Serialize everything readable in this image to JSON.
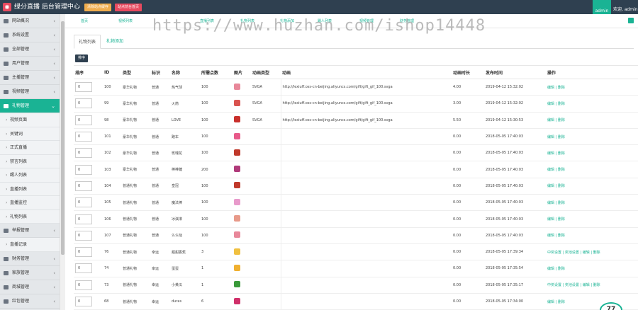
{
  "app": {
    "logo_glyph": "◉",
    "title": "绿分直播 后台管理中心"
  },
  "topbar": {
    "clear_cache": "清除站点缓存",
    "site_home": "站点前台首页",
    "avatar_text": "admin",
    "welcome": "欢迎, admin"
  },
  "sidebar": {
    "items_top": [
      {
        "label": "网站概况"
      },
      {
        "label": "系统设置"
      },
      {
        "label": "全部管理"
      },
      {
        "label": "用户管理"
      },
      {
        "label": "主播管理"
      },
      {
        "label": "视频管理"
      }
    ],
    "active": {
      "label": "礼物管理"
    },
    "subs": [
      {
        "label": "视频页面"
      },
      {
        "label": "关键词"
      },
      {
        "label": "正式直播"
      },
      {
        "label": "禁言列表"
      },
      {
        "label": "踢人列表"
      },
      {
        "label": "直播列表"
      },
      {
        "label": "直播监控"
      },
      {
        "label": "礼物列表"
      }
    ],
    "mid": {
      "label": "举报管理"
    },
    "sub2": {
      "label": "直播记录"
    },
    "items_bottom": [
      {
        "label": "财务管理"
      },
      {
        "label": "家族管理"
      },
      {
        "label": "商城管理"
      },
      {
        "label": "红包管理"
      },
      {
        "label": "守护管理"
      }
    ]
  },
  "tabbar": [
    "首页",
    "视频列表",
    "直播列表",
    "礼物列表",
    "礼物添加",
    "踢人列表",
    "视频管理",
    "财务管理"
  ],
  "watermark": "https://www.huzhan.com/ishop14448",
  "subtabs": {
    "list": "礼物列表",
    "add": "礼物添加"
  },
  "sort_button": "排序",
  "table": {
    "headers": [
      "排序",
      "ID",
      "类型",
      "标识",
      "名称",
      "所需点数",
      "图片",
      "动画类型",
      "动画",
      "动画时长",
      "发布时间",
      "操作"
    ],
    "rows": [
      {
        "order": "0",
        "id": "100",
        "type": "豪华礼物",
        "mark": "普通",
        "name": "热气球",
        "points": "100",
        "anim_type": "SVGA",
        "anim": "http://lexiuff.oss-cn-beijing.aliyuncs.com/gift/gift_gif_100.svga",
        "duration": "4.00",
        "time": "2019-04-12 15:32:02",
        "action": "编辑 | 删除",
        "color": "#e8889a"
      },
      {
        "order": "0",
        "id": "99",
        "type": "豪华礼物",
        "mark": "普通",
        "name": "火箭",
        "points": "100",
        "anim_type": "SVGA",
        "anim": "http://lexiuff.oss-cn-beijing.aliyuncs.com/gift/gift_gif_100.svga",
        "duration": "3.00",
        "time": "2019-04-12 15:32:02",
        "action": "编辑 | 删除",
        "color": "#d9534f"
      },
      {
        "order": "0",
        "id": "98",
        "type": "豪华礼物",
        "mark": "普通",
        "name": "LOVE",
        "points": "100",
        "anim_type": "SVGA",
        "anim": "http://lexiuff.oss-cn-beijing.aliyuncs.com/gift/gift_gif_100.svga",
        "duration": "5.50",
        "time": "2019-04-12 15:30:53",
        "action": "编辑 | 删除",
        "color": "#c9302c"
      },
      {
        "order": "0",
        "id": "101",
        "type": "豪华礼物",
        "mark": "普通",
        "name": "跑车",
        "points": "100",
        "anim_type": "",
        "anim": "",
        "duration": "0.00",
        "time": "2018-05-05 17:40:03",
        "action": "编辑 | 删除",
        "color": "#e85a8a"
      },
      {
        "order": "0",
        "id": "102",
        "type": "豪华礼物",
        "mark": "普通",
        "name": "玫瑰花",
        "points": "100",
        "anim_type": "",
        "anim": "",
        "duration": "0.00",
        "time": "2018-05-05 17:40:03",
        "action": "编辑 | 删除",
        "color": "#c0392b"
      },
      {
        "order": "0",
        "id": "103",
        "type": "豪华礼物",
        "mark": "普通",
        "name": "棒棒糖",
        "points": "200",
        "anim_type": "",
        "anim": "",
        "duration": "0.00",
        "time": "2018-05-05 17:40:03",
        "action": "编辑 | 删除",
        "color": "#b03a7a"
      },
      {
        "order": "0",
        "id": "104",
        "type": "普通礼物",
        "mark": "普通",
        "name": "皇冠",
        "points": "100",
        "anim_type": "",
        "anim": "",
        "duration": "0.00",
        "time": "2018-05-05 17:40:03",
        "action": "编辑 | 删除",
        "color": "#c0392b"
      },
      {
        "order": "0",
        "id": "105",
        "type": "普通礼物",
        "mark": "普通",
        "name": "魔法棒",
        "points": "100",
        "anim_type": "",
        "anim": "",
        "duration": "0.00",
        "time": "2018-05-05 17:40:03",
        "action": "编辑 | 删除",
        "color": "#e89acb"
      },
      {
        "order": "0",
        "id": "106",
        "type": "普通礼物",
        "mark": "普通",
        "name": "冰淇淋",
        "points": "100",
        "anim_type": "",
        "anim": "",
        "duration": "0.00",
        "time": "2018-05-05 17:40:03",
        "action": "编辑 | 删除",
        "color": "#e89a8a"
      },
      {
        "order": "0",
        "id": "107",
        "type": "普通礼物",
        "mark": "普通",
        "name": "么么哒",
        "points": "100",
        "anim_type": "",
        "anim": "",
        "duration": "0.00",
        "time": "2018-05-05 17:40:03",
        "action": "编辑 | 删除",
        "color": "#e8889a"
      },
      {
        "order": "0",
        "id": "76",
        "type": "普通礼物",
        "mark": "幸运",
        "name": "甜甜香蕉",
        "points": "3",
        "anim_type": "",
        "anim": "",
        "duration": "0.00",
        "time": "2018-05-05 17:39:34",
        "action": "中奖设置 | 奖池设置 | 编辑 | 删除",
        "color": "#f0c040"
      },
      {
        "order": "0",
        "id": "74",
        "type": "普通礼物",
        "mark": "幸运",
        "name": "蛋蛋",
        "points": "1",
        "anim_type": "",
        "anim": "",
        "duration": "0.00",
        "time": "2018-05-05 17:35:54",
        "action": "编辑 | 删除",
        "color": "#f0b030"
      },
      {
        "order": "0",
        "id": "73",
        "type": "普通礼物",
        "mark": "幸运",
        "name": "小黄瓜",
        "points": "1",
        "anim_type": "",
        "anim": "",
        "duration": "0.00",
        "time": "2018-05-05 17:35:17",
        "action": "中奖设置 | 奖池设置 | 编辑 | 删除",
        "color": "#3a9a3a"
      },
      {
        "order": "0",
        "id": "68",
        "type": "普通礼物",
        "mark": "幸运",
        "name": "duras",
        "points": "6",
        "anim_type": "",
        "anim": "",
        "duration": "0.00",
        "time": "2018-05-05 17:34:00",
        "action": "编辑 | 删除",
        "color": "#d0306a"
      }
    ]
  },
  "badge": "77"
}
